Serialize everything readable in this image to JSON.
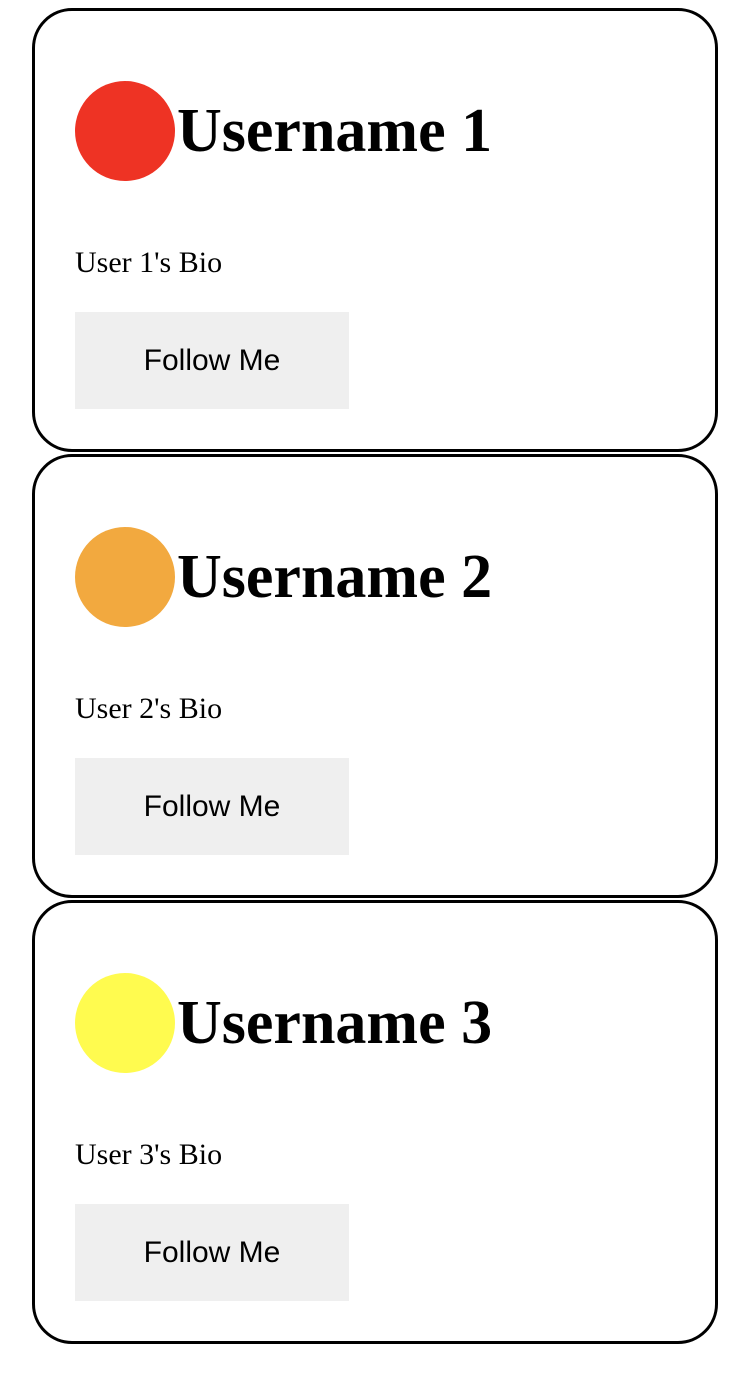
{
  "profiles": [
    {
      "username": "Username 1",
      "bio": "User 1's Bio",
      "button_label": "Follow Me",
      "avatar_color": "#EE3324"
    },
    {
      "username": "Username 2",
      "bio": "User 2's Bio",
      "button_label": "Follow Me",
      "avatar_color": "#F2A93F"
    },
    {
      "username": "Username 3",
      "bio": "User 3's Bio",
      "button_label": "Follow Me",
      "avatar_color": "#FFFB4F"
    }
  ]
}
